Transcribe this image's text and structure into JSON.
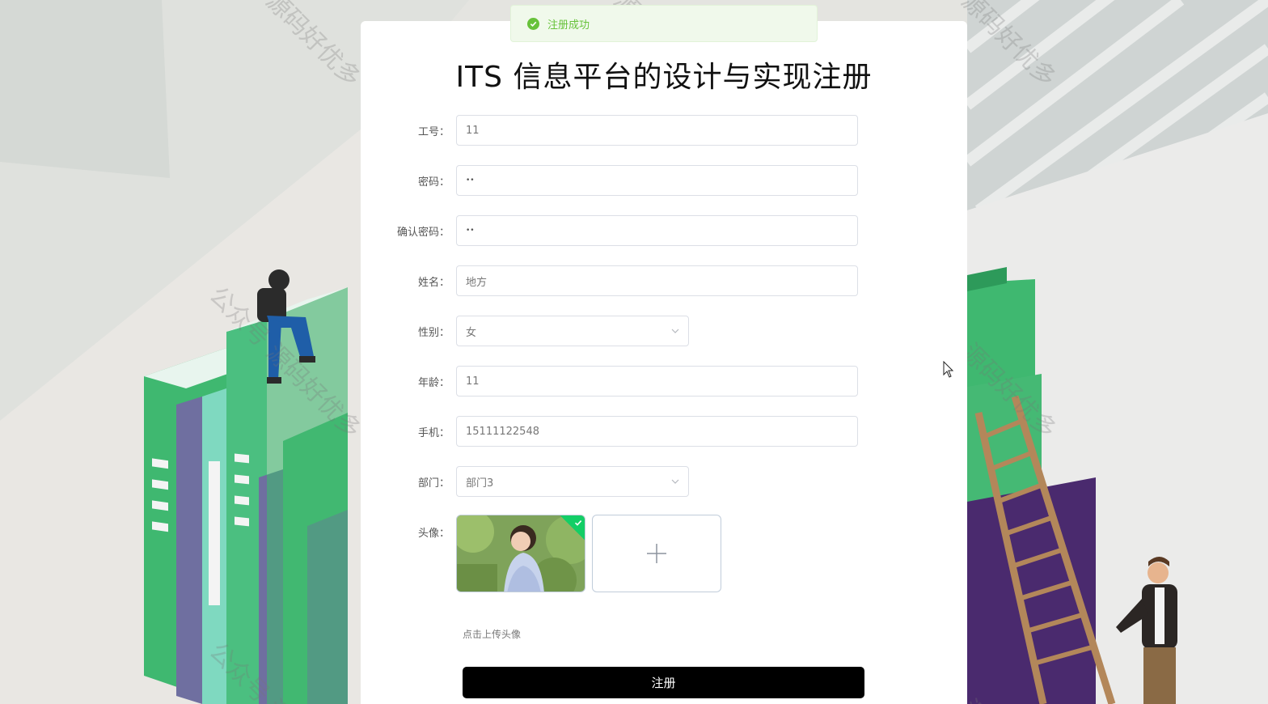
{
  "toast": {
    "message": "注册成功",
    "color": "#67c23a"
  },
  "form": {
    "title": "ITS 信息平台的设计与实现注册",
    "fields": [
      {
        "label": "工号：",
        "value": "11"
      },
      {
        "label": "密码：",
        "value": "••"
      },
      {
        "label": "确认密码：",
        "value": "••"
      },
      {
        "label": "姓名：",
        "value": "地方"
      },
      {
        "label": "性别：",
        "value": "女",
        "type": "select"
      },
      {
        "label": "年龄：",
        "value": "11"
      },
      {
        "label": "手机：",
        "value": "15111122548"
      },
      {
        "label": "部门：",
        "value": "部门3",
        "type": "select"
      }
    ],
    "avatar": {
      "label": "头像：",
      "tip": "点击上传头像",
      "uploaded_icon": "check-icon",
      "add_icon": "plus-icon"
    },
    "submit_label": "注册",
    "submit_color": "#000000"
  },
  "watermark": "公众号 源码好优多",
  "watermark_fragments": [
    "源码好优多",
    "公众号",
    "公众号 源"
  ]
}
